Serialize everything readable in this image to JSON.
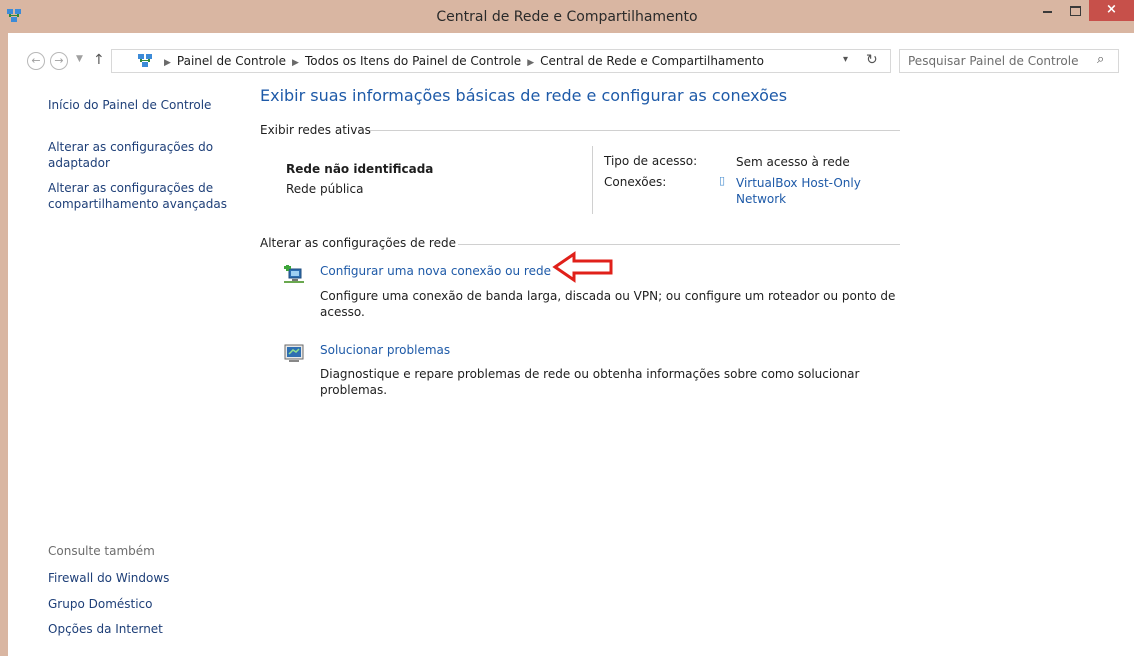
{
  "window": {
    "title": "Central de Rede e Compartilhamento",
    "close_label": "×",
    "accent_color": "#d9b6a2",
    "close_color": "#c7504a"
  },
  "nav": {
    "back_icon": "back-arrow-icon",
    "forward_icon": "forward-arrow-icon",
    "up_icon": "up-arrow-icon",
    "breadcrumb": [
      "Painel de Controle",
      "Todos os Itens do Painel de Controle",
      "Central de Rede e Compartilhamento"
    ],
    "search_placeholder": "Pesquisar Painel de Controle"
  },
  "sidebar": {
    "home": "Início do Painel de Controle",
    "links": [
      "Alterar as configurações do adaptador",
      "Alterar as configurações de compartilhamento avançadas"
    ],
    "see_also_heading": "Consulte também",
    "see_also": [
      "Firewall do Windows",
      "Grupo Doméstico",
      "Opções da Internet"
    ]
  },
  "main": {
    "title": "Exibir suas informações básicas de rede e configurar as conexões",
    "active_networks": {
      "heading": "Exibir redes ativas",
      "network_name": "Rede não identificada",
      "network_category": "Rede pública",
      "access_type_label": "Tipo de acesso:",
      "access_type_value": "Sem acesso à rede",
      "connections_label": "Conexões:",
      "connection_value_line1": "VirtualBox Host-Only",
      "connection_value_line2": "Network"
    },
    "change_settings": {
      "heading": "Alterar as configurações de rede",
      "tasks": [
        {
          "link": "Configurar uma nova conexão ou rede",
          "desc_line1": "Configure uma conexão de banda larga, discada ou VPN; ou configure um roteador ou ponto de",
          "desc_line2": "acesso."
        },
        {
          "link": "Solucionar problemas",
          "desc_line1": "Diagnostique e repare problemas de rede ou obtenha informações sobre como solucionar",
          "desc_line2": "problemas."
        }
      ]
    }
  },
  "annotation": {
    "arrow_color": "#e0201a"
  }
}
